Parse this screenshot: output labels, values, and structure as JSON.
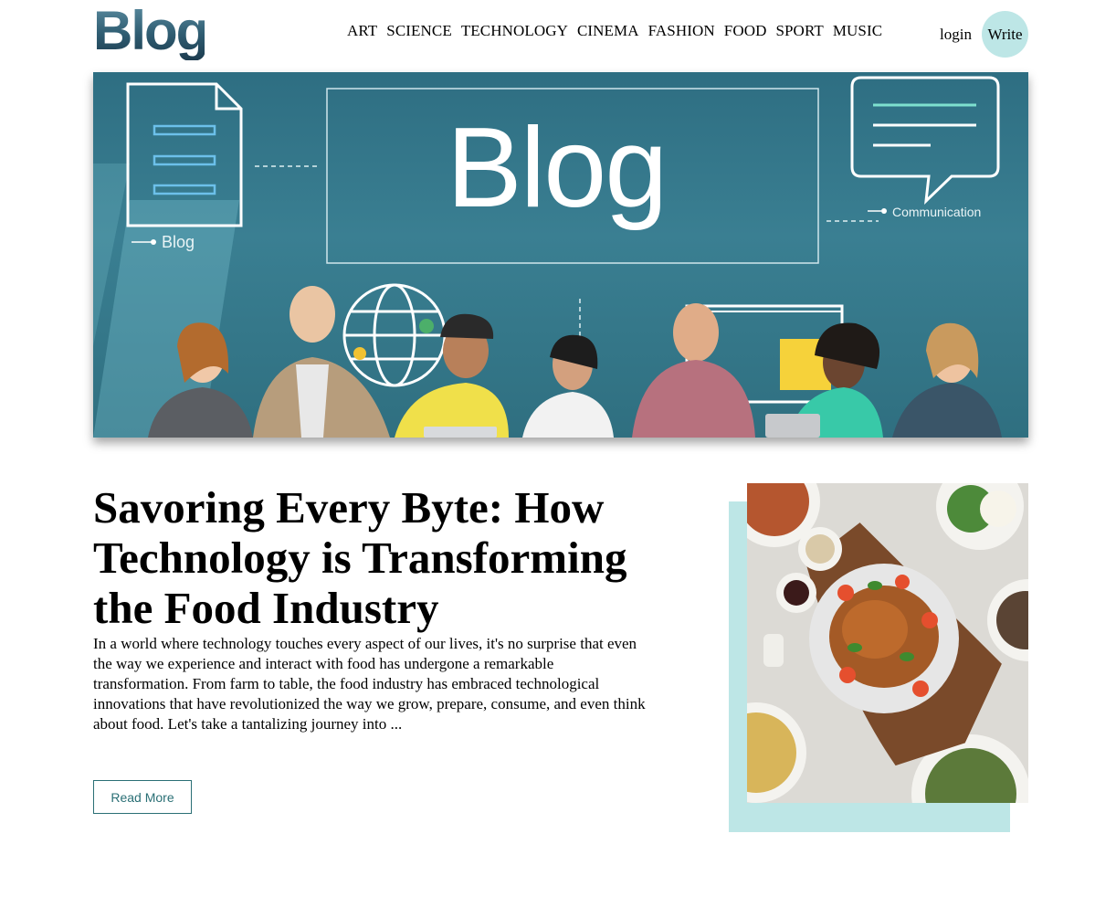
{
  "logo": {
    "text": "Blog"
  },
  "nav": {
    "links": [
      "ART",
      "SCIENCE",
      "TECHNOLOGY",
      "CINEMA",
      "FASHION",
      "FOOD",
      "SPORT",
      "MUSIC"
    ],
    "login": "login",
    "write": "Write"
  },
  "hero": {
    "title": "Blog",
    "tag_blog": "Blog",
    "tag_communication": "Communication"
  },
  "post": {
    "title": "Savoring Every Byte: How Technology is Transforming the Food Industry",
    "excerpt": "In a world where technology touches every aspect of our lives, it's no surprise that even the way we experience and interact with food has undergone a remarkable transformation. From farm to table, the food industry has embraced technological innovations that have revolutionized the way we grow, prepare, consume, and even think about food. Let's take a tantalizing journey into ...",
    "read_more": "Read More"
  },
  "colors": {
    "accent": "#bde6e6",
    "button_text": "#2a6f75",
    "hero_bg": "#2e6e82"
  }
}
